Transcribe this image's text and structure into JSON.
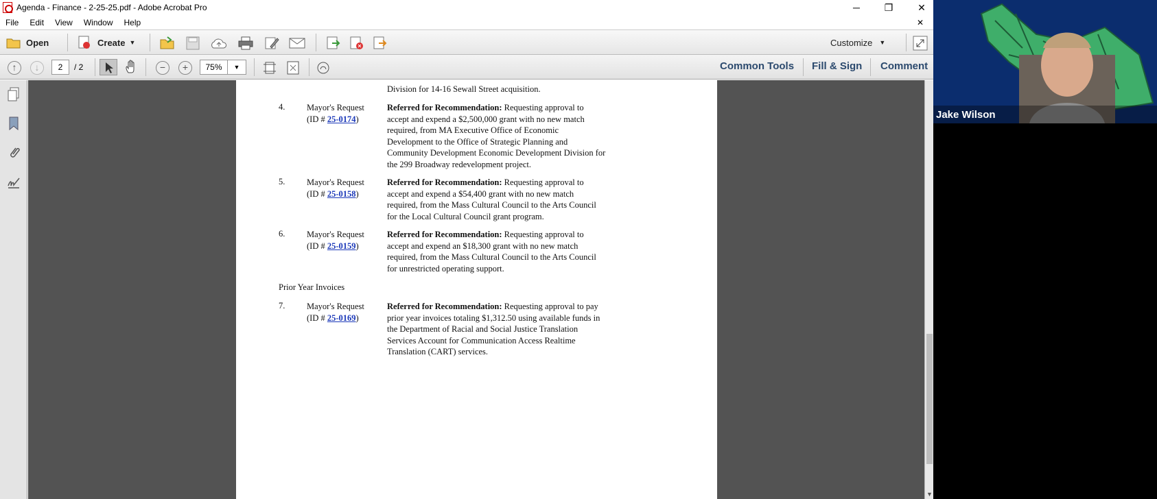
{
  "window": {
    "title": "Agenda - Finance - 2-25-25.pdf - Adobe Acrobat Pro",
    "minimize": "─",
    "restore": "❐",
    "close": "✕"
  },
  "menu": {
    "items": [
      "File",
      "Edit",
      "View",
      "Window",
      "Help"
    ],
    "close": "✕"
  },
  "toolbar": {
    "open_label": "Open",
    "create_label": "Create",
    "customize_label": "Customize"
  },
  "nav": {
    "current_page": "2",
    "total_pages": "/ 2",
    "zoom": "75%"
  },
  "panels": {
    "common_tools": "Common Tools",
    "fill_sign": "Fill & Sign",
    "comment": "Comment"
  },
  "document": {
    "top_line": "Division for 14-16 Sewall Street acquisition.",
    "section_heading": "Prior Year Invoices",
    "items": [
      {
        "num": "4.",
        "requester": "Mayor's Request",
        "id_prefix": "(ID # ",
        "id": "25-0174",
        "id_suffix": ")",
        "ref": "Referred for Recommendation:",
        "text": "Requesting approval to accept and expend a $2,500,000 grant with no new match required, from MA Executive Office of Economic Development to the Office of Strategic Planning and Community Development Economic Development Division for the 299 Broadway redevelopment project."
      },
      {
        "num": "5.",
        "requester": "Mayor's Request",
        "id_prefix": "(ID # ",
        "id": "25-0158",
        "id_suffix": ")",
        "ref": "Referred for Recommendation:",
        "text": "Requesting approval to accept and expend a $54,400 grant with no new match required, from the Mass Cultural Council to the Arts Council for the Local Cultural Council grant program."
      },
      {
        "num": "6.",
        "requester": "Mayor's Request",
        "id_prefix": "(ID # ",
        "id": "25-0159",
        "id_suffix": ")",
        "ref": "Referred for Recommendation:",
        "text": "Requesting approval to accept and expend an $18,300 grant with no new match required, from the Mass Cultural Council to the Arts Council for unrestricted operating support."
      },
      {
        "num": "7.",
        "requester": "Mayor's Request",
        "id_prefix": "(ID # ",
        "id": "25-0169",
        "id_suffix": ")",
        "ref": "Referred for Recommendation:",
        "text": "Requesting approval to pay prior year invoices totaling $1,312.50 using available funds in the Department of Racial and Social Justice Translation Services Account for Communication Access Realtime Translation (CART) services."
      }
    ]
  },
  "video": {
    "participant_name": "Jake Wilson"
  }
}
